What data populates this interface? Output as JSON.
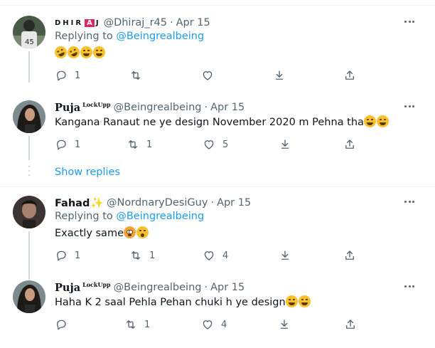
{
  "tweets": [
    {
      "display_name": "DHIRAJ",
      "display_name_parts": [
        "DHIR",
        "A",
        "J"
      ],
      "handle": "@Dhiraj_r45",
      "date": "Apr 15",
      "replying_prefix": "Replying to ",
      "replying_to": "@Beingrealbeing",
      "text": "",
      "emojis": [
        "rofl",
        "rofl",
        "joy",
        "joy"
      ],
      "counts": {
        "reply": "1",
        "retweet": "",
        "like": ""
      }
    },
    {
      "display_name": "Puja",
      "name_badge": "LockUpp",
      "handle": "@Beingrealbeing",
      "date": "Apr 15",
      "text": "Kangana Ranaut ne ye design November 2020 m Pehna tha",
      "emojis": [
        "joy",
        "joy"
      ],
      "counts": {
        "reply": "1",
        "retweet": "1",
        "like": "5"
      }
    },
    {
      "display_name": "Fahad",
      "handle": "@NordnaryDesiGuy",
      "date": "Apr 15",
      "replying_prefix": "Replying to ",
      "replying_to": "@Beingrealbeing",
      "text": "Exactly same",
      "emojis": [
        "flushed",
        "scream"
      ],
      "counts": {
        "reply": "1",
        "retweet": "1",
        "like": "4"
      }
    },
    {
      "display_name": "Puja",
      "name_badge": "LockUpp",
      "handle": "@Beingrealbeing",
      "date": "Apr 15",
      "text": "Haha K 2 saal Pehla Pehan chuki h ye design",
      "emojis": [
        "joy",
        "joy"
      ],
      "counts": {
        "reply": "",
        "retweet": "1",
        "like": "4"
      }
    }
  ],
  "show_replies": "Show replies",
  "dot": "·",
  "icons": {
    "more": "more-icon",
    "reply": "reply-icon",
    "retweet": "retweet-icon",
    "like": "like-icon",
    "download": "download-icon",
    "share": "share-icon"
  },
  "colors": {
    "link": "#1d9bf0",
    "muted": "#536471",
    "text": "#0f1419"
  }
}
